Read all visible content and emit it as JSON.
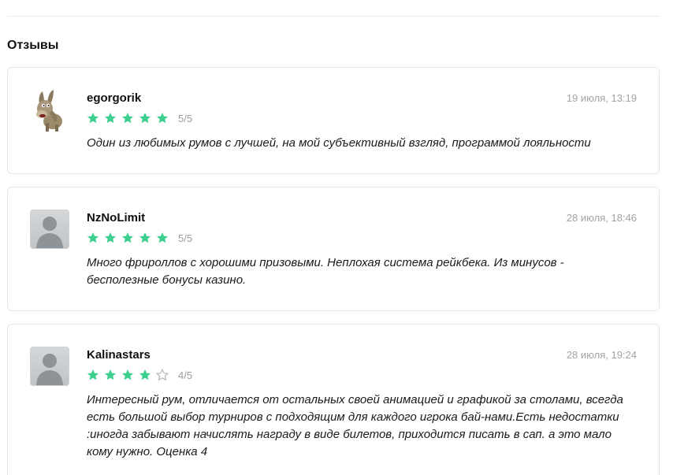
{
  "section": {
    "title": "Отзывы"
  },
  "colors": {
    "star_filled": "#3ecf8e",
    "star_empty": "#b9b9b9",
    "date_text": "#a3a3a3"
  },
  "reviews": [
    {
      "author": "egorgorik",
      "date": "19 июля, 13:19",
      "rating": 5,
      "rating_text": "5/5",
      "avatar": "donkey-avatar",
      "text": "Один из любимых румов с лучшей, на мой субъективный взгляд, программой лояльности"
    },
    {
      "author": "NzNoLimit",
      "date": "28 июля, 18:46",
      "rating": 5,
      "rating_text": "5/5",
      "avatar": "default-user-avatar",
      "text": "Много фрироллов с хорошими призовыми. Неплохая система рейкбека. Из минусов - бесполезные бонусы казино."
    },
    {
      "author": "Kalinastars",
      "date": "28 июля, 19:24",
      "rating": 4,
      "rating_text": "4/5",
      "avatar": "default-user-avatar",
      "text": "Интересный рум, отличается от остальных своей анимацией и графикой за столами, всегда есть большой выбор турниров с подходящим для каждого игрока бай-нами.Есть недостатки :иногда забывают начислять награду в виде билетов, приходится писать в сап. а это мало кому нужно. Оценка 4"
    }
  ]
}
